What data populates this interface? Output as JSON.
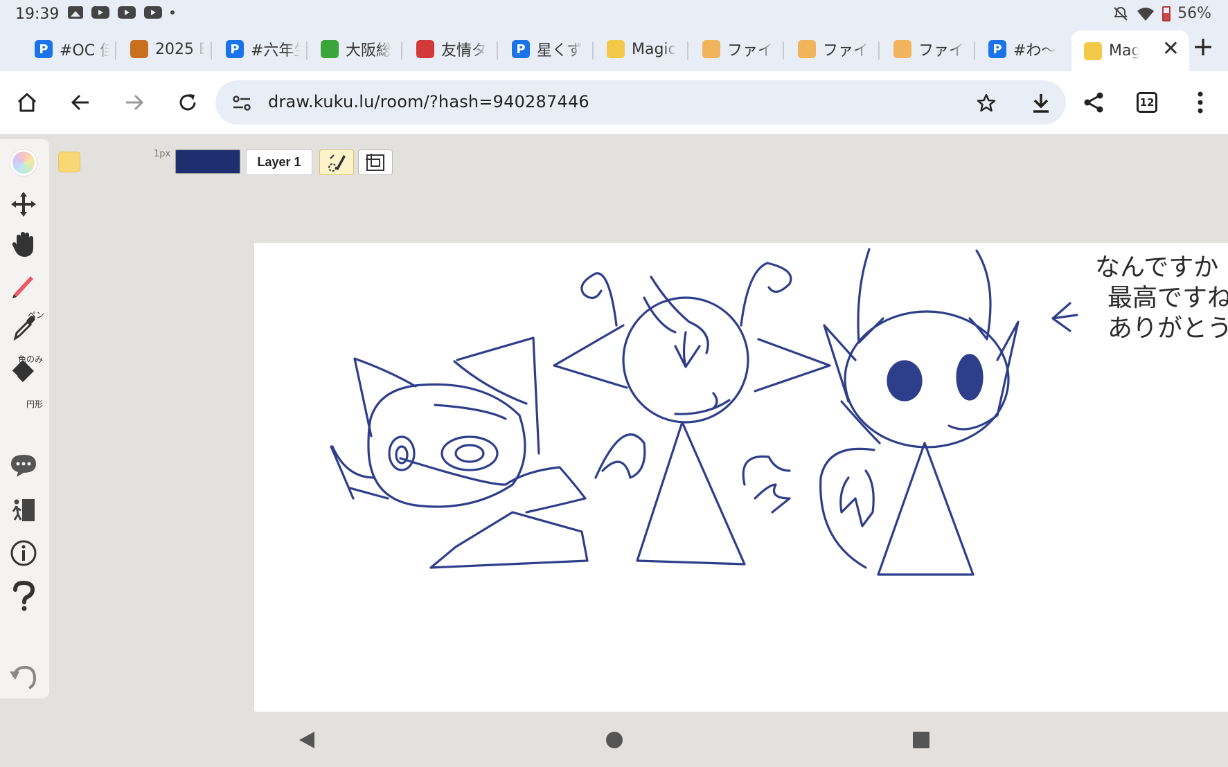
{
  "status": {
    "time": "19:39",
    "battery": "56%"
  },
  "tabs": [
    {
      "title": "#OC 佳",
      "fav_text": "P",
      "fav_color": "#1a73e8"
    },
    {
      "title": "2025 E",
      "fav_text": "",
      "fav_color": "#c8701e"
    },
    {
      "title": "#六年生",
      "fav_text": "P",
      "fav_color": "#1a73e8"
    },
    {
      "title": "大阪総",
      "fav_text": "",
      "fav_color": "#3aa63a"
    },
    {
      "title": "友情タ",
      "fav_text": "",
      "fav_color": "#d23a3a"
    },
    {
      "title": "星くず",
      "fav_text": "P",
      "fav_color": "#1a73e8"
    },
    {
      "title": "Magic",
      "fav_text": "",
      "fav_color": "#f3c94a"
    },
    {
      "title": "ファイ",
      "fav_text": "",
      "fav_color": "#f1b35c"
    },
    {
      "title": "ファイ",
      "fav_text": "",
      "fav_color": "#f1b35c"
    },
    {
      "title": "ファイ",
      "fav_text": "",
      "fav_color": "#f1b35c"
    },
    {
      "title": "#わ〜",
      "fav_text": "P",
      "fav_color": "#1a73e8"
    },
    {
      "title": "Mag",
      "fav_text": "",
      "fav_color": "#f3c94a",
      "active": true
    }
  ],
  "toolbar": {
    "url": "draw.kuku.lu/room/?hash=940287446",
    "tab_count": "12"
  },
  "sidebar": {
    "pen_caption": "ペン",
    "picker_caption": "色のみ",
    "eraser_caption": "円形"
  },
  "drawing_tools": {
    "brush_size": "1px",
    "current_color": "#1f2e6e",
    "secondary_color": "#f8d774",
    "layer_label": "Layer 1"
  },
  "canvas": {
    "note_line1": "なんですか",
    "note_line2": "最高ですね",
    "note_line3": "ありがとう"
  }
}
